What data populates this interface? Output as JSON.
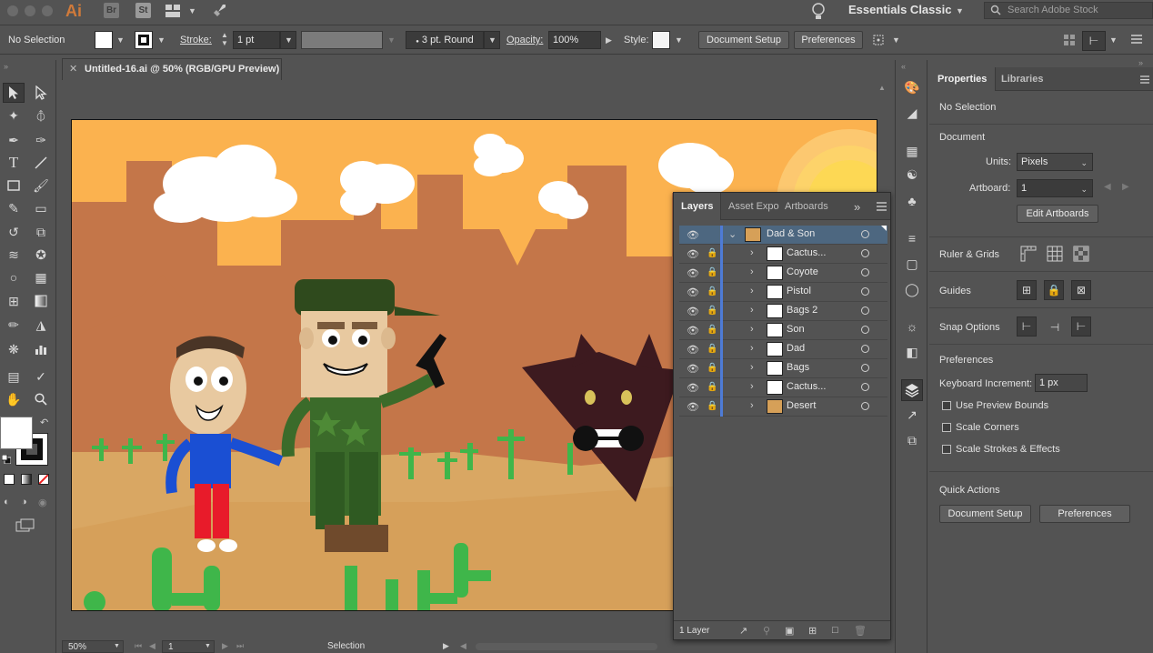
{
  "menubar": {
    "app_icon": "Ai",
    "bridge_icon": "Br",
    "stock_icon": "St",
    "workspace_label": "Essentials Classic",
    "search_placeholder": "Search Adobe Stock"
  },
  "control_bar": {
    "selection_state": "No Selection",
    "stroke_label": "Stroke:",
    "stroke_value": "1 pt",
    "brush_label": "3 pt. Round",
    "opacity_label": "Opacity:",
    "opacity_value": "100%",
    "style_label": "Style:",
    "document_setup_button": "Document Setup",
    "preferences_button": "Preferences"
  },
  "document": {
    "tab_title": "Untitled-16.ai @ 50% (RGB/GPU Preview)"
  },
  "status_bar": {
    "zoom": "50%",
    "artboard_number": "1",
    "tool_name": "Selection"
  },
  "layers_panel": {
    "tabs": [
      "Layers",
      "Asset Expo",
      "Artboards"
    ],
    "parent_layer": "Dad & Son",
    "sublayers": [
      "Cactus...",
      "Coyote",
      "Pistol",
      "Bags 2",
      "Son",
      "Dad",
      "Bags",
      "Cactus...",
      "Desert"
    ],
    "footer_count": "1 Layer"
  },
  "properties_panel": {
    "tabs": [
      "Properties",
      "Libraries"
    ],
    "selection_state": "No Selection",
    "document_title": "Document",
    "units_label": "Units:",
    "units_value": "Pixels",
    "artboard_label": "Artboard:",
    "artboard_value": "1",
    "edit_artboards_button": "Edit Artboards",
    "ruler_grids_title": "Ruler & Grids",
    "guides_title": "Guides",
    "snap_options_title": "Snap Options",
    "preferences_title": "Preferences",
    "keyboard_increment_label": "Keyboard Increment:",
    "keyboard_increment_value": "1 px",
    "use_preview_bounds": "Use Preview Bounds",
    "scale_corners": "Scale Corners",
    "scale_strokes_effects": "Scale Strokes & Effects",
    "quick_actions_title": "Quick Actions",
    "document_setup_button": "Document Setup",
    "preferences_button": "Preferences"
  },
  "colors": {
    "sky": "#fbb24f",
    "mountains": "#c47649",
    "ground": "#d9a763",
    "cactus": "#3fb64a",
    "layer_selected": "#4e7bd6"
  }
}
